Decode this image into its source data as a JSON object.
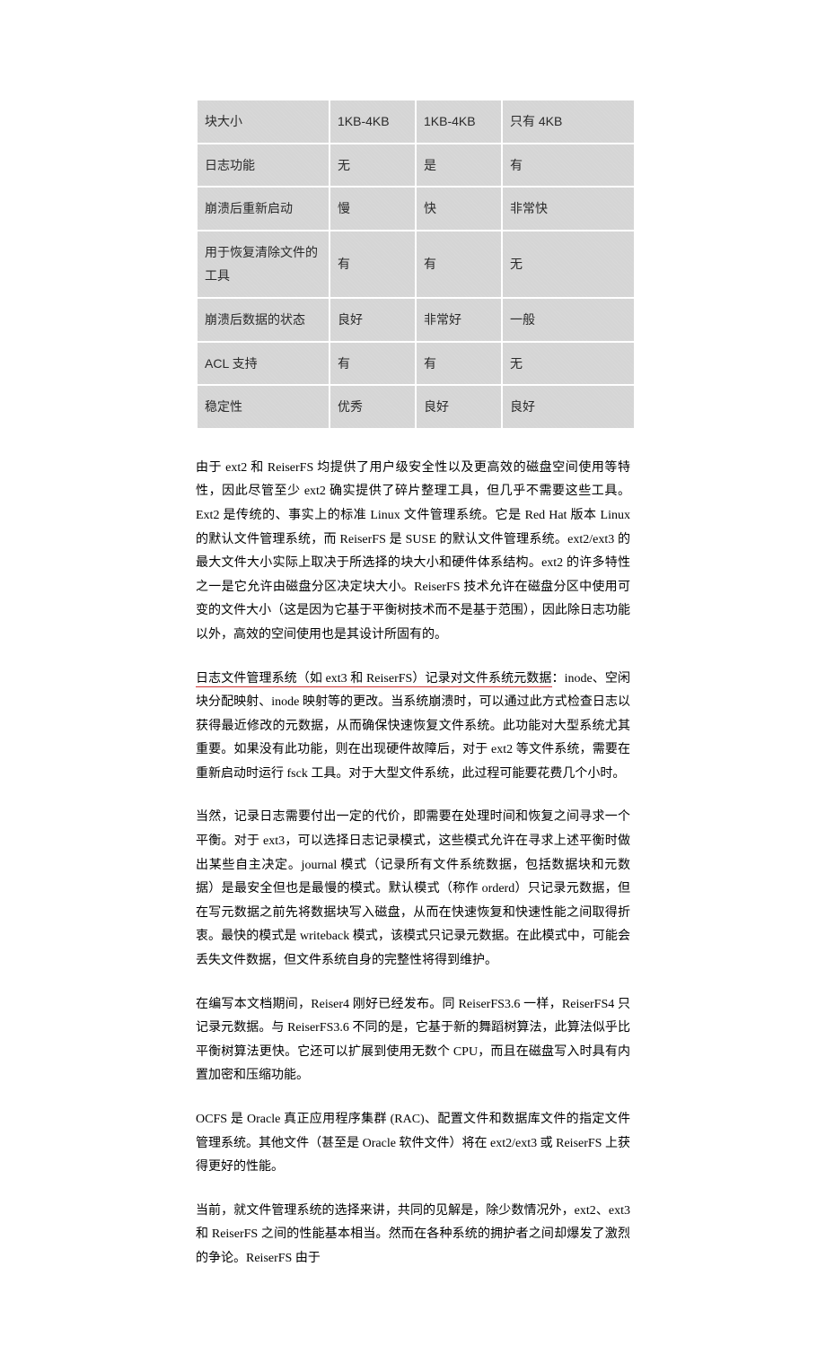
{
  "table": {
    "rows": [
      {
        "c0": "块大小",
        "c1": "1KB-4KB",
        "c2": "1KB-4KB",
        "c3": "只有 4KB"
      },
      {
        "c0": "日志功能",
        "c1": "无",
        "c2": "是",
        "c3": "有"
      },
      {
        "c0": "崩溃后重新启动",
        "c1": "慢",
        "c2": "快",
        "c3": "非常快"
      },
      {
        "c0": "用于恢复清除文件的工具",
        "c1": "有",
        "c2": "有",
        "c3": "无"
      },
      {
        "c0": "崩溃后数据的状态",
        "c1": "良好",
        "c2": "非常好",
        "c3": "一般"
      },
      {
        "c0": "ACL 支持",
        "c1": "有",
        "c2": "有",
        "c3": "无"
      },
      {
        "c0": "稳定性",
        "c1": "优秀",
        "c2": "良好",
        "c3": "良好"
      }
    ]
  },
  "paragraphs": {
    "p1": "由于 ext2 和 ReiserFS 均提供了用户级安全性以及更高效的磁盘空间使用等特性，因此尽管至少 ext2 确实提供了碎片整理工具，但几乎不需要这些工具。Ext2 是传统的、事实上的标准 Linux 文件管理系统。它是 Red Hat 版本 Linux 的默认文件管理系统，而 ReiserFS 是 SUSE 的默认文件管理系统。ext2/ext3 的最大文件大小实际上取决于所选择的块大小和硬件体系结构。ext2 的许多特性之一是它允许由磁盘分区决定块大小。ReiserFS 技术允许在磁盘分区中使用可变的文件大小（这是因为它基于平衡树技术而不是基于范围），因此除日志功能以外，高效的空间使用也是其设计所固有的。",
    "p2_underline": "日志文件管理系统（如 ext3 和 ReiserFS）记录对文件系统元数据",
    "p2_rest": "：inode、空闲块分配映射、inode 映射等的更改。当系统崩溃时，可以通过此方式检查日志以获得最近修改的元数据，从而确保快速恢复文件系统。此功能对大型系统尤其重要。如果没有此功能，则在出现硬件故障后，对于 ext2 等文件系统，需要在重新启动时运行 fsck 工具。对于大型文件系统，此过程可能要花费几个小时。",
    "p3": "当然，记录日志需要付出一定的代价，即需要在处理时间和恢复之间寻求一个平衡。对于 ext3，可以选择日志记录模式，这些模式允许在寻求上述平衡时做出某些自主决定。journal 模式（记录所有文件系统数据，包括数据块和元数据）是最安全但也是最慢的模式。默认模式（称作 orderd）只记录元数据，但在写元数据之前先将数据块写入磁盘，从而在快速恢复和快速性能之间取得折衷。最快的模式是 writeback 模式，该模式只记录元数据。在此模式中，可能会丢失文件数据，但文件系统自身的完整性将得到维护。",
    "p4": "在编写本文档期间，Reiser4 刚好已经发布。同 ReiserFS3.6 一样，ReiserFS4 只记录元数据。与 ReiserFS3.6 不同的是，它基于新的舞蹈树算法，此算法似乎比平衡树算法更快。它还可以扩展到使用无数个 CPU，而且在磁盘写入时具有内置加密和压缩功能。",
    "p5": "OCFS 是 Oracle 真正应用程序集群 (RAC)、配置文件和数据库文件的指定文件管理系统。其他文件（甚至是 Oracle 软件文件）将在 ext2/ext3 或 ReiserFS 上获得更好的性能。",
    "p6": "当前，就文件管理系统的选择来讲，共同的见解是，除少数情况外，ext2、ext3 和 ReiserFS 之间的性能基本相当。然而在各种系统的拥护者之间却爆发了激烈的争论。ReiserFS 由于"
  }
}
